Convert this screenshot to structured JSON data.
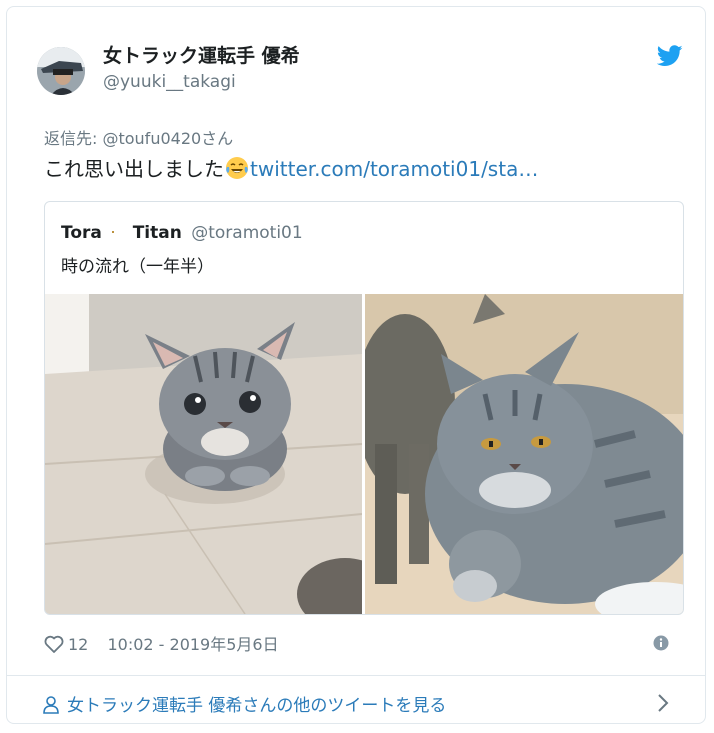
{
  "author": {
    "display_name": "女トラック運転手 優希",
    "handle": "@yuuki__takagi"
  },
  "reply_to": "返信先: @toufu0420さん",
  "tweet": {
    "text": "これ思い出しました",
    "link": "twitter.com/toramoti01/sta…"
  },
  "quoted": {
    "name_part1": "Tora",
    "name_part2": "Titan",
    "handle": "@toramoti01",
    "text": "時の流れ（一年半）"
  },
  "footer": {
    "likes": "12",
    "timestamp": "10:02 - 2019年5月6日"
  },
  "more_link": "女トラック運転手 優希さんの他のツイートを見る",
  "colors": {
    "link": "#2b7bb9",
    "muted": "#697882",
    "twitter_blue": "#1da1f2",
    "border": "#e1e8ed"
  },
  "icons": [
    "twitter-bird-icon",
    "moon-emoji-icon",
    "tears-of-joy-emoji-icon",
    "heart-icon",
    "info-icon",
    "person-icon",
    "chevron-right-icon"
  ]
}
